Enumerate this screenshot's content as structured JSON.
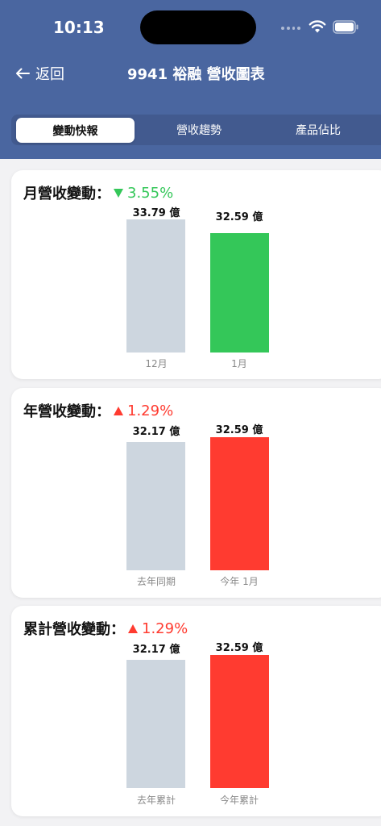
{
  "status": {
    "time": "10:13"
  },
  "nav": {
    "back_label": "返回",
    "title": "9941 裕融 營收圖表"
  },
  "tabs": [
    {
      "label": "變動快報",
      "active": true
    },
    {
      "label": "營收趨勢",
      "active": false
    },
    {
      "label": "產品佔比",
      "active": false
    }
  ],
  "colors": {
    "header": "#4a66a0",
    "neutral_bar": "#cdd6df",
    "down": "#34c759",
    "up": "#ff3b30"
  },
  "cards": [
    {
      "title": "月營收變動：",
      "direction": "down",
      "change": "3.55%",
      "bars": [
        {
          "label": "12月",
          "value": 33.79,
          "value_text": "33.79 億",
          "color": "#cdd6df"
        },
        {
          "label": "1月",
          "value": 32.59,
          "value_text": "32.59 億",
          "color": "#34c759"
        }
      ]
    },
    {
      "title": "年營收變動：",
      "direction": "up",
      "change": "1.29%",
      "bars": [
        {
          "label": "去年同期",
          "value": 32.17,
          "value_text": "32.17 億",
          "color": "#cdd6df"
        },
        {
          "label": "今年 1月",
          "value": 32.59,
          "value_text": "32.59 億",
          "color": "#ff3b30"
        }
      ]
    },
    {
      "title": "累計營收變動：",
      "direction": "up",
      "change": "1.29%",
      "bars": [
        {
          "label": "去年累計",
          "value": 32.17,
          "value_text": "32.17 億",
          "color": "#cdd6df"
        },
        {
          "label": "今年累計",
          "value": 32.59,
          "value_text": "32.59 億",
          "color": "#ff3b30"
        }
      ]
    }
  ]
}
